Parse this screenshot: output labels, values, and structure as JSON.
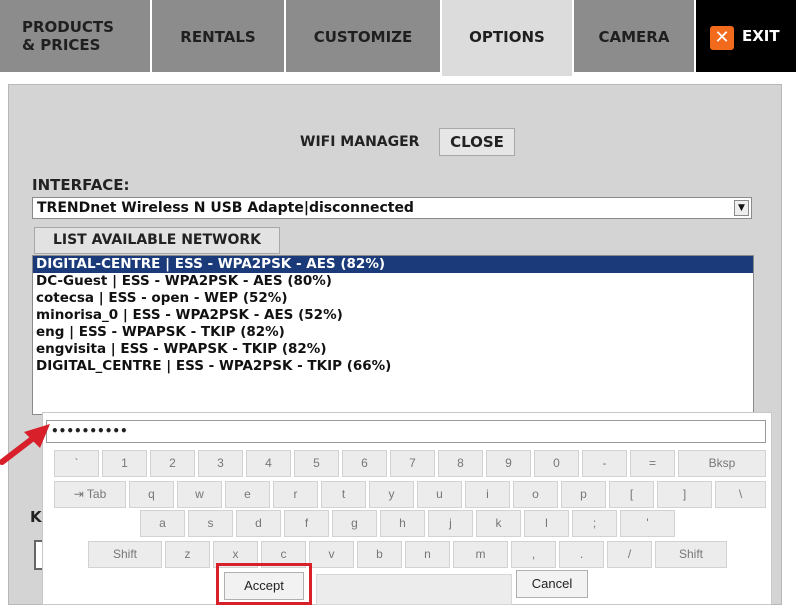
{
  "tabs": {
    "products": "PRODUCTS & PRICES",
    "products_line1": "PRODUCTS",
    "products_line2": "& PRICES",
    "rentals": "RENTALS",
    "customize": "CUSTOMIZE",
    "options": "OPTIONS",
    "camera": "CAMERA",
    "exit": "EXIT"
  },
  "wifi": {
    "title": "WIFI MANAGER",
    "close_label": "CLOSE",
    "interface_label": "INTERFACE:",
    "interface_value": "TRENDnet Wireless N USB Adapte|disconnected",
    "list_button": "LIST AVAILABLE NETWORK",
    "networks": [
      "DIGITAL-CENTRE | ESS - WPA2PSK - AES (82%)",
      "DC-Guest | ESS - WPA2PSK - AES (80%)",
      "cotecsa | ESS - open - WEP (52%)",
      "minorisa_0 | ESS - WPA2PSK - AES (52%)",
      "eng | ESS - WPAPSK - TKIP (82%)",
      "engvisita | ESS - WPAPSK - TKIP (82%)",
      "DIGITAL_CENTRE | ESS - WPA2PSK - TKIP (66%)"
    ],
    "selected_network_index": 0,
    "partial_label": "K"
  },
  "keyboard": {
    "password_value": "••••••••••",
    "row1": [
      "`",
      "1",
      "2",
      "3",
      "4",
      "5",
      "6",
      "7",
      "8",
      "9",
      "0",
      "-",
      "=",
      "Bksp"
    ],
    "row2": [
      "⇥ Tab",
      "q",
      "w",
      "e",
      "r",
      "t",
      "y",
      "u",
      "i",
      "o",
      "p",
      "[",
      "]",
      "\\"
    ],
    "row3": [
      "a",
      "s",
      "d",
      "f",
      "g",
      "h",
      "j",
      "k",
      "l",
      ";",
      "'"
    ],
    "row4": [
      "Shift",
      "z",
      "x",
      "c",
      "v",
      "b",
      "n",
      "m",
      ",",
      ".",
      "/",
      "Shift"
    ],
    "accept_label": "Accept",
    "cancel_label": "Cancel"
  },
  "colors": {
    "tab_bg": "#8c8c8c",
    "tab_active_bg": "#dcdcdc",
    "exit_bg": "#000000",
    "exit_icon": "#f26a1b",
    "selection": "#1a3a7a",
    "highlight": "#d8202a",
    "arrow": "#d8202a"
  }
}
